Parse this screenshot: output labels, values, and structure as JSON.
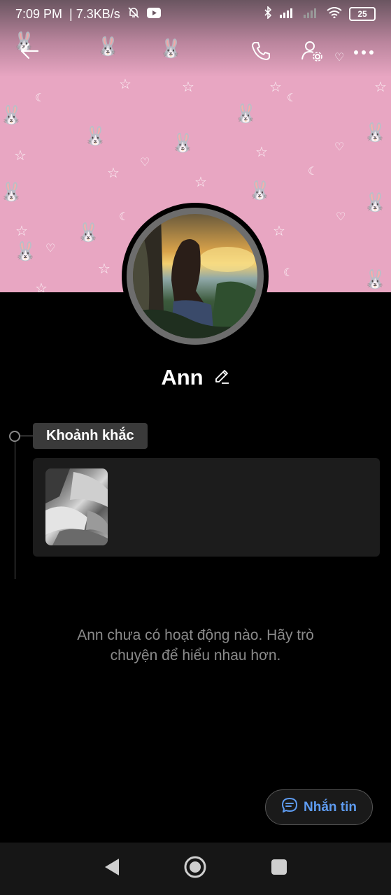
{
  "status_bar": {
    "time": "7:09 PM",
    "speed": "| 7.3KB/s",
    "battery": "25"
  },
  "profile": {
    "name": "Ann"
  },
  "moments": {
    "label": "Khoảnh khắc"
  },
  "empty_state": {
    "line1": "Ann chưa có hoạt động nào. Hãy trò",
    "line2": "chuyện để hiểu nhau hơn."
  },
  "message_button": {
    "label": "Nhắn tin"
  },
  "colors": {
    "accent": "#5e9bf0",
    "cover_pink": "#e8a6c2",
    "background": "#000000"
  },
  "icons": [
    "back-arrow-icon",
    "phone-icon",
    "user-settings-icon",
    "more-icon",
    "edit-icon",
    "chat-bubble-icon",
    "nav-back-icon",
    "nav-home-icon",
    "nav-recents-icon",
    "bluetooth-icon",
    "signal-icon",
    "wifi-icon",
    "mute-bell-icon",
    "youtube-icon"
  ]
}
